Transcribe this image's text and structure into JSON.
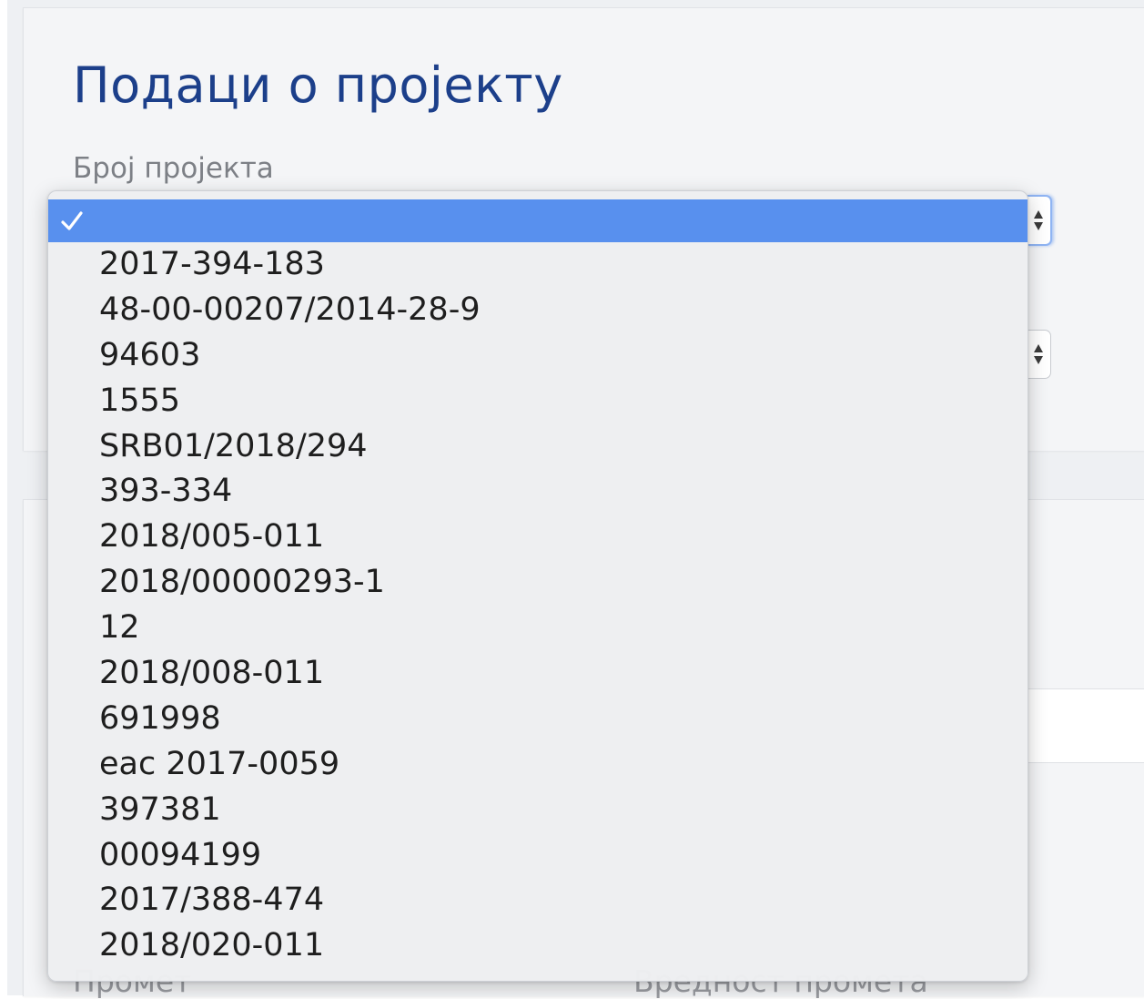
{
  "project_section": {
    "title": "Подаци о пројекту",
    "project_number_label": "Број пројекта"
  },
  "dropdown": {
    "selected_option": "",
    "options": [
      "",
      "2017-394-183",
      "48-00-00207/2014-28-9",
      "94603",
      "1555",
      "SRB01/2018/294",
      "393-334",
      "2018/005-011",
      "2018/00000293-1",
      "12",
      "2018/008-011",
      "691998",
      "eac 2017-0059",
      "397381",
      "00094199",
      "2017/388-474",
      "2018/020-011"
    ]
  },
  "lower_section": {
    "turnover_label": "Промет",
    "turnover_value_label": "Вредност промета"
  },
  "icons": {
    "check": "check-icon",
    "select_arrows": "updown-icon"
  },
  "colors": {
    "title": "#1c3f8a",
    "selection": "#5890ee",
    "focus_ring": "#8fb4f3"
  }
}
